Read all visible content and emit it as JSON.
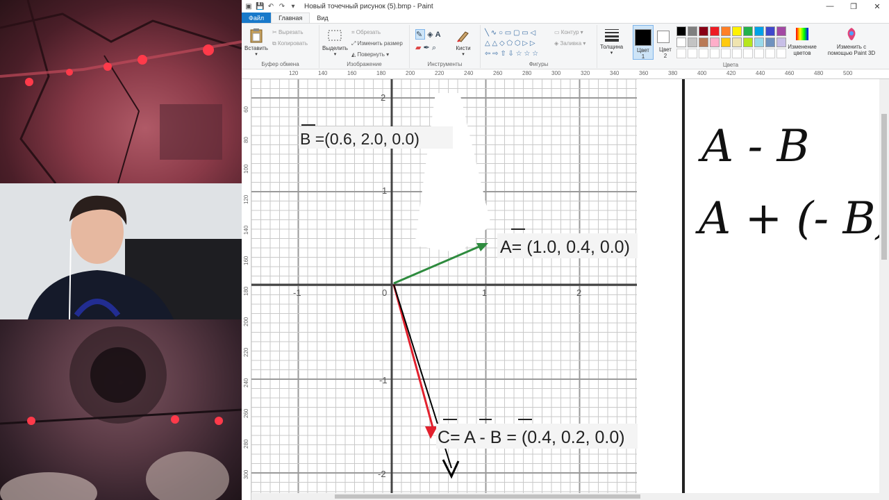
{
  "window": {
    "title": "Новый точечный рисунок (5).bmp - Paint",
    "controls": {
      "minimize": "—",
      "maximize": "❐",
      "close": "✕"
    },
    "quick_access": [
      "💾",
      "↶",
      "↷",
      "▾"
    ]
  },
  "tabs": [
    {
      "label": "Файл"
    },
    {
      "label": "Главная"
    },
    {
      "label": "Вид"
    }
  ],
  "ribbon": {
    "clipboard": {
      "label": "Буфер обмена",
      "paste": "Вставить",
      "cut": "Вырезать",
      "copy": "Копировать"
    },
    "image": {
      "label": "Изображение",
      "select": "Выделить",
      "crop": "Обрезать",
      "resize": "Изменить размер",
      "rotate": "Повернуть"
    },
    "tools": {
      "label": "Инструменты",
      "brushes": "Кисти"
    },
    "shapes": {
      "label": "Фигуры",
      "outline": "Контур",
      "fill": "Заливка"
    },
    "thickness": "Толщина",
    "color1": {
      "line1": "Цвет",
      "line2": "1"
    },
    "color2": {
      "line1": "Цвет",
      "line2": "2"
    },
    "colors": {
      "label": "Цвета",
      "edit_line1": "Изменение",
      "edit_line2": "цветов"
    },
    "paint3d": {
      "line1": "Изменить с",
      "line2": "помощью Paint 3D"
    },
    "palette": [
      "#000000",
      "#7f7f7f",
      "#880015",
      "#ed1c24",
      "#ff7f27",
      "#fff200",
      "#22b14c",
      "#00a2e8",
      "#3f48cc",
      "#a349a4",
      "#ffffff",
      "#c3c3c3",
      "#b97a57",
      "#ffaec9",
      "#ffc90e",
      "#efe4b0",
      "#b5e61d",
      "#99d9ea",
      "#7092be",
      "#c8bfe7"
    ]
  },
  "ruler": {
    "h": [
      "120",
      "140",
      "160",
      "180",
      "200",
      "220",
      "240",
      "260",
      "280",
      "300",
      "320",
      "340",
      "360",
      "380",
      "400",
      "420",
      "440",
      "460",
      "480",
      "500"
    ],
    "v": [
      "60",
      "80",
      "100",
      "120",
      "140",
      "160",
      "180",
      "200",
      "220",
      "240",
      "260",
      "280",
      "300"
    ]
  },
  "graph": {
    "x_ticks": [
      "-1",
      "0",
      "1",
      "2"
    ],
    "y_ticks": [
      "2",
      "1",
      "-1",
      "-2"
    ],
    "label_b": "B =(0.6, 2.0, 0.0)",
    "label_a": "A= (1.0, 0.4, 0.0)",
    "label_c": "C= A - B = (0.4, 0.2, 0.0)"
  },
  "handwriting": {
    "line1": "A - B",
    "line2": "A + (- B)"
  },
  "colors": {
    "vector_a": "#2e8b3e",
    "vector_c": "#e2202d",
    "accent": "#1979ca"
  }
}
